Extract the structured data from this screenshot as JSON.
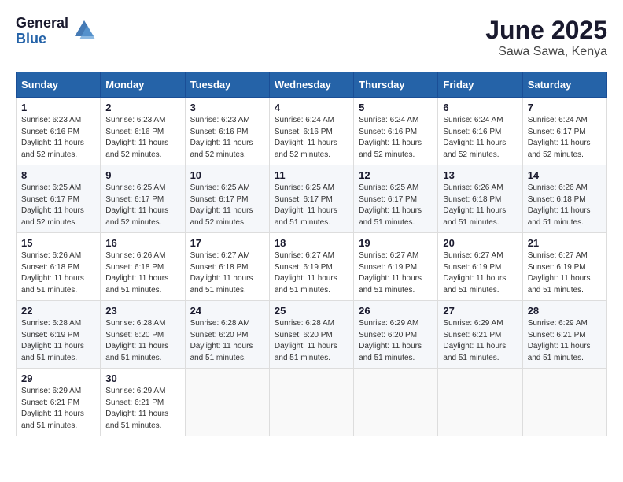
{
  "logo": {
    "general": "General",
    "blue": "Blue"
  },
  "title": {
    "month": "June 2025",
    "location": "Sawa Sawa, Kenya"
  },
  "headers": [
    "Sunday",
    "Monday",
    "Tuesday",
    "Wednesday",
    "Thursday",
    "Friday",
    "Saturday"
  ],
  "weeks": [
    [
      {
        "day": "1",
        "sunrise": "6:23 AM",
        "sunset": "6:16 PM",
        "daylight": "11 hours and 52 minutes."
      },
      {
        "day": "2",
        "sunrise": "6:23 AM",
        "sunset": "6:16 PM",
        "daylight": "11 hours and 52 minutes."
      },
      {
        "day": "3",
        "sunrise": "6:23 AM",
        "sunset": "6:16 PM",
        "daylight": "11 hours and 52 minutes."
      },
      {
        "day": "4",
        "sunrise": "6:24 AM",
        "sunset": "6:16 PM",
        "daylight": "11 hours and 52 minutes."
      },
      {
        "day": "5",
        "sunrise": "6:24 AM",
        "sunset": "6:16 PM",
        "daylight": "11 hours and 52 minutes."
      },
      {
        "day": "6",
        "sunrise": "6:24 AM",
        "sunset": "6:16 PM",
        "daylight": "11 hours and 52 minutes."
      },
      {
        "day": "7",
        "sunrise": "6:24 AM",
        "sunset": "6:17 PM",
        "daylight": "11 hours and 52 minutes."
      }
    ],
    [
      {
        "day": "8",
        "sunrise": "6:25 AM",
        "sunset": "6:17 PM",
        "daylight": "11 hours and 52 minutes."
      },
      {
        "day": "9",
        "sunrise": "6:25 AM",
        "sunset": "6:17 PM",
        "daylight": "11 hours and 52 minutes."
      },
      {
        "day": "10",
        "sunrise": "6:25 AM",
        "sunset": "6:17 PM",
        "daylight": "11 hours and 52 minutes."
      },
      {
        "day": "11",
        "sunrise": "6:25 AM",
        "sunset": "6:17 PM",
        "daylight": "11 hours and 51 minutes."
      },
      {
        "day": "12",
        "sunrise": "6:25 AM",
        "sunset": "6:17 PM",
        "daylight": "11 hours and 51 minutes."
      },
      {
        "day": "13",
        "sunrise": "6:26 AM",
        "sunset": "6:18 PM",
        "daylight": "11 hours and 51 minutes."
      },
      {
        "day": "14",
        "sunrise": "6:26 AM",
        "sunset": "6:18 PM",
        "daylight": "11 hours and 51 minutes."
      }
    ],
    [
      {
        "day": "15",
        "sunrise": "6:26 AM",
        "sunset": "6:18 PM",
        "daylight": "11 hours and 51 minutes."
      },
      {
        "day": "16",
        "sunrise": "6:26 AM",
        "sunset": "6:18 PM",
        "daylight": "11 hours and 51 minutes."
      },
      {
        "day": "17",
        "sunrise": "6:27 AM",
        "sunset": "6:18 PM",
        "daylight": "11 hours and 51 minutes."
      },
      {
        "day": "18",
        "sunrise": "6:27 AM",
        "sunset": "6:19 PM",
        "daylight": "11 hours and 51 minutes."
      },
      {
        "day": "19",
        "sunrise": "6:27 AM",
        "sunset": "6:19 PM",
        "daylight": "11 hours and 51 minutes."
      },
      {
        "day": "20",
        "sunrise": "6:27 AM",
        "sunset": "6:19 PM",
        "daylight": "11 hours and 51 minutes."
      },
      {
        "day": "21",
        "sunrise": "6:27 AM",
        "sunset": "6:19 PM",
        "daylight": "11 hours and 51 minutes."
      }
    ],
    [
      {
        "day": "22",
        "sunrise": "6:28 AM",
        "sunset": "6:19 PM",
        "daylight": "11 hours and 51 minutes."
      },
      {
        "day": "23",
        "sunrise": "6:28 AM",
        "sunset": "6:20 PM",
        "daylight": "11 hours and 51 minutes."
      },
      {
        "day": "24",
        "sunrise": "6:28 AM",
        "sunset": "6:20 PM",
        "daylight": "11 hours and 51 minutes."
      },
      {
        "day": "25",
        "sunrise": "6:28 AM",
        "sunset": "6:20 PM",
        "daylight": "11 hours and 51 minutes."
      },
      {
        "day": "26",
        "sunrise": "6:29 AM",
        "sunset": "6:20 PM",
        "daylight": "11 hours and 51 minutes."
      },
      {
        "day": "27",
        "sunrise": "6:29 AM",
        "sunset": "6:21 PM",
        "daylight": "11 hours and 51 minutes."
      },
      {
        "day": "28",
        "sunrise": "6:29 AM",
        "sunset": "6:21 PM",
        "daylight": "11 hours and 51 minutes."
      }
    ],
    [
      {
        "day": "29",
        "sunrise": "6:29 AM",
        "sunset": "6:21 PM",
        "daylight": "11 hours and 51 minutes."
      },
      {
        "day": "30",
        "sunrise": "6:29 AM",
        "sunset": "6:21 PM",
        "daylight": "11 hours and 51 minutes."
      },
      null,
      null,
      null,
      null,
      null
    ]
  ],
  "labels": {
    "sunrise": "Sunrise:",
    "sunset": "Sunset:",
    "daylight": "Daylight:"
  }
}
